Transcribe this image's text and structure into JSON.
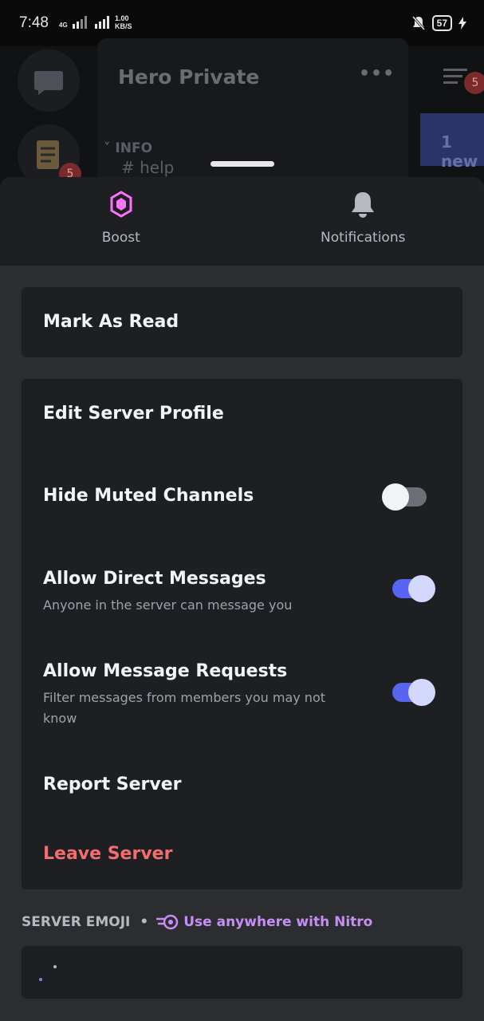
{
  "status_bar": {
    "time": "7:48",
    "network": "4G",
    "net_speed_value": "1.00",
    "net_speed_unit": "KB/S",
    "battery": "57"
  },
  "background": {
    "server_title": "Hero Private",
    "more": "•••",
    "section": "˅ INFO",
    "channel": "# help",
    "banner": "1 new",
    "badge_rail": "5",
    "badge_top": "5"
  },
  "sheet": {
    "actions": [
      {
        "label": "Boost",
        "icon": "boost-gem-icon",
        "color": "#ff73fa"
      },
      {
        "label": "Notifications",
        "icon": "bell-icon",
        "color": "#b5bac1"
      }
    ],
    "mark_as_read": "Mark As Read",
    "edit_server_profile": "Edit Server Profile",
    "hide_muted": {
      "label": "Hide Muted Channels",
      "enabled": false
    },
    "allow_dms": {
      "label": "Allow Direct Messages",
      "description": "Anyone in the server can message you",
      "enabled": true
    },
    "allow_requests": {
      "label": "Allow Message Requests",
      "description": "Filter messages from members you may not know",
      "enabled": true
    },
    "report_server": "Report Server",
    "leave_server": "Leave Server",
    "emoji_section": {
      "label": "SERVER EMOJI",
      "separator": "•",
      "nitro_text": "Use anywhere with Nitro"
    }
  },
  "colors": {
    "accent": "#5865f2",
    "danger": "#f26d6d",
    "nitro": "#c88df7"
  }
}
